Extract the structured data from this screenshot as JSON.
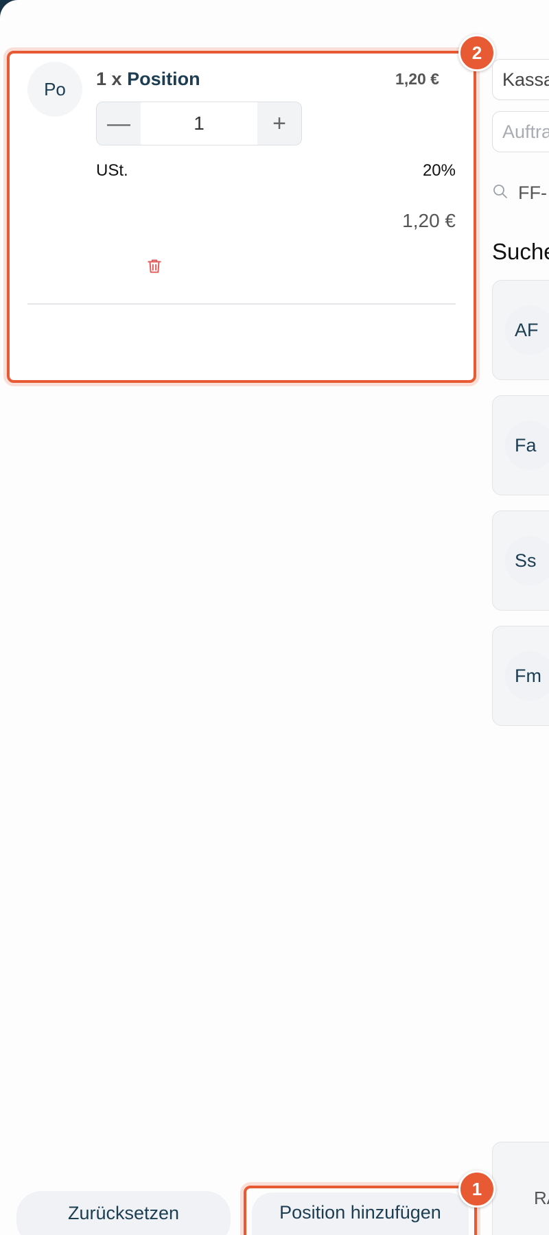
{
  "cart_item": {
    "avatar": "Po",
    "quantity_prefix": "1 x",
    "name": "Position",
    "unit_price": "1,20 €",
    "stepper": {
      "minus": "—",
      "value": "1",
      "plus": "+"
    },
    "tax_label": "USt.",
    "tax_value": "20%",
    "line_total": "1,20 €"
  },
  "badges": {
    "cart_item": "2",
    "add_button": "1"
  },
  "right_panel": {
    "register_field": "Kassa",
    "order_field_placeholder": "Auftra",
    "search_text": "FF-",
    "section_title": "Suche",
    "customers": [
      "AF",
      "Fa",
      "Ss",
      "Fm"
    ],
    "summary_text": "RA"
  },
  "footer": {
    "reset_label": "Zurücksetzen",
    "add_position_label": "Position hinzufügen"
  },
  "colors": {
    "accent": "#e85a33",
    "brand_dark": "#1c3d52",
    "danger": "#e45a5a"
  }
}
